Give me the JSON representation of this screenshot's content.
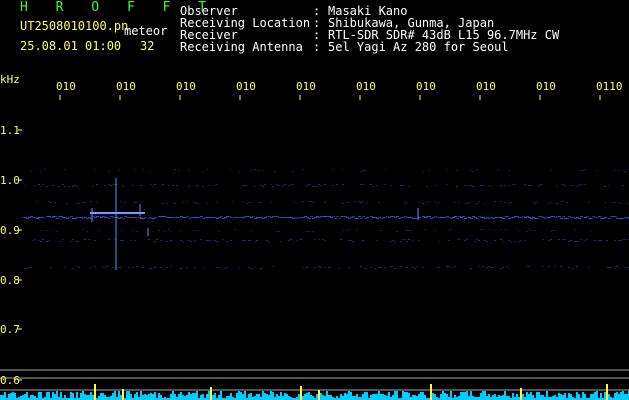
{
  "header": {
    "app_name": "H R O F F T",
    "filename": "UT2508010100.pn",
    "meteor_label": "meteor",
    "datetime": "25.08.01 01:00",
    "meteor_count": "32",
    "info": [
      {
        "label": "Observer",
        "value": "Masaki Kano"
      },
      {
        "label": "Receiving Location",
        "value": "Shibukawa, Gunma, Japan"
      },
      {
        "label": "Receiver",
        "value": "RTL-SDR SDR# 43dB L15 96.7MHz CW"
      },
      {
        "label": "Receiving Antenna",
        "value": "5el Yagi Az 280 for Seoul"
      }
    ]
  },
  "axes": {
    "y_unit": "kHz",
    "y_ticks": [
      "1.1",
      "1.0",
      "0.9",
      "0.8",
      "0.7",
      "0.6"
    ],
    "x_ticks": [
      "010",
      "010",
      "010",
      "010",
      "010",
      "010",
      "010",
      "010",
      "010",
      "0110"
    ]
  },
  "colors": {
    "background": "#000000",
    "label_white": "#ffffff",
    "label_yellow": "#ffff66",
    "title_green": "#33ff33",
    "signal_blue": "#3355ff",
    "bottom_cyan": "#00ccff"
  }
}
